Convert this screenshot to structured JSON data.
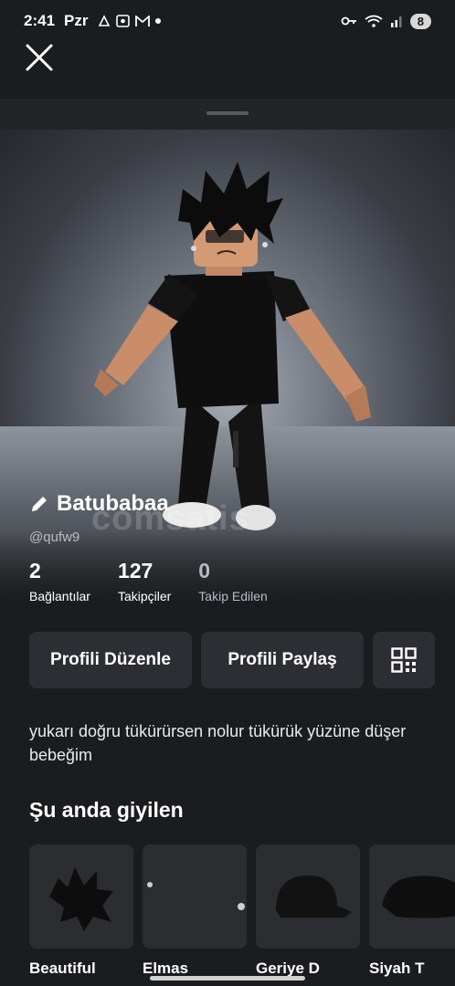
{
  "status": {
    "time": "2:41",
    "day": "Pzr",
    "battery": "8"
  },
  "profile": {
    "display_name": "Batubabaa",
    "username": "@qufw9",
    "watermark": "comsatis"
  },
  "stats": [
    {
      "value": "2",
      "label": "Bağlantılar"
    },
    {
      "value": "127",
      "label": "Takipçiler"
    },
    {
      "value": "0",
      "label": "Takip Edilen"
    }
  ],
  "actions": {
    "edit_label": "Profili Düzenle",
    "share_label": "Profili Paylaş"
  },
  "bio": "yukarı doğru tükürürsen nolur tükürük yüzüne düşer bebeğim",
  "wearing": {
    "title": "Şu anda giyilen",
    "items": [
      {
        "label": "Beautiful"
      },
      {
        "label": "Elmas"
      },
      {
        "label": "Geriye D"
      },
      {
        "label": "Siyah T"
      }
    ]
  },
  "icons": {
    "close": "close-icon",
    "edit": "pencil-icon",
    "qr": "qr-code-icon"
  }
}
